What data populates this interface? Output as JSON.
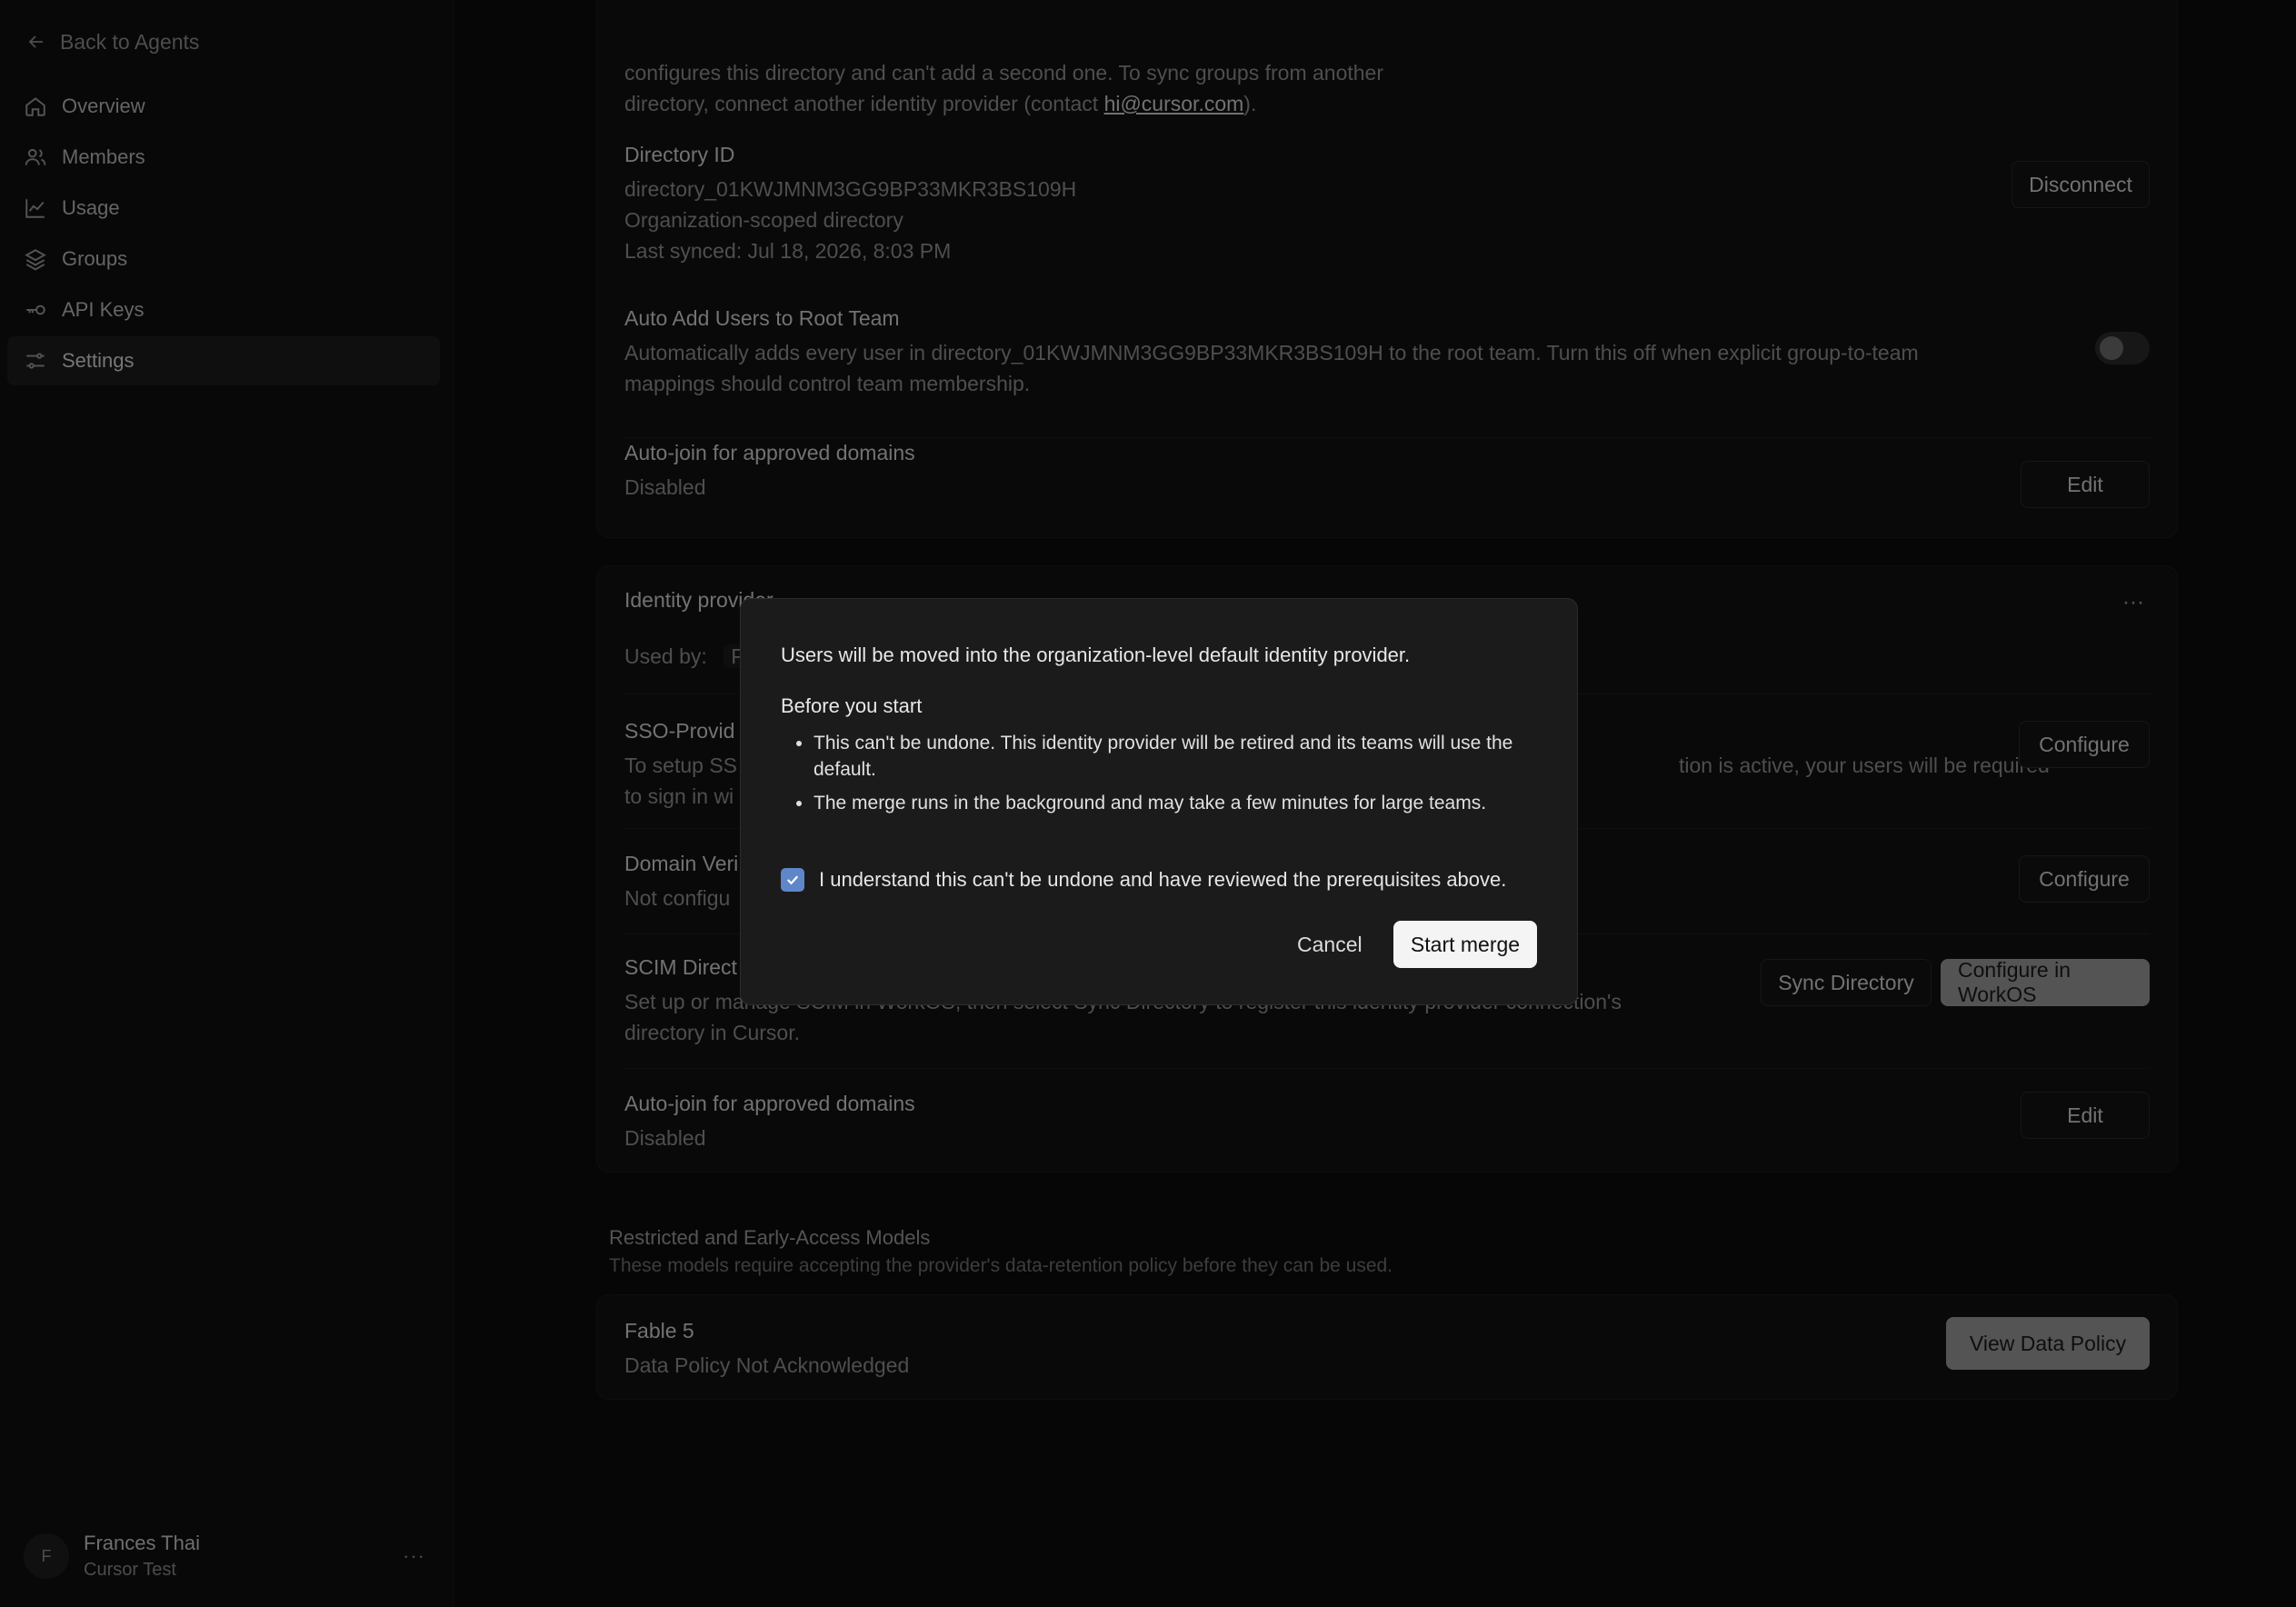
{
  "sidebar": {
    "back_label": "Back to Agents",
    "items": [
      {
        "label": "Overview",
        "icon": "home-icon"
      },
      {
        "label": "Members",
        "icon": "users-icon"
      },
      {
        "label": "Usage",
        "icon": "chart-icon"
      },
      {
        "label": "Groups",
        "icon": "layers-icon"
      },
      {
        "label": "API Keys",
        "icon": "key-icon"
      },
      {
        "label": "Settings",
        "icon": "sliders-icon",
        "active": true
      }
    ],
    "user": {
      "initial": "F",
      "name": "Frances Thai",
      "org": "Cursor Test",
      "more": "···"
    }
  },
  "directory_card": {
    "intro_line1": "configures this directory and can't add a second one. To sync groups from another",
    "intro_line2_prefix": "directory, connect another identity provider (contact ",
    "intro_link": "hi@cursor.com",
    "intro_line2_suffix": ").",
    "directory_id_title": "Directory ID",
    "directory_id": "directory_01KWJMNM3GG9BP33MKR3BS109H",
    "scope": "Organization-scoped directory",
    "last_synced": "Last synced: Jul 18, 2026, 8:03 PM",
    "disconnect_label": "Disconnect",
    "auto_add_title": "Auto Add Users to Root Team",
    "auto_add_desc_line1": "Automatically adds every user in directory_01KWJMNM3GG9BP33MKR3BS109H to the root team. Turn this off when explicit group-to-team",
    "auto_add_desc_line2": "mappings should control team membership.",
    "autojoin_title": "Auto-join for approved domains",
    "autojoin_status": "Disabled",
    "edit_label": "Edit"
  },
  "idp_card": {
    "title": "Identity provider",
    "more": "···",
    "used_by_label": "Used by:",
    "used_by_value": "P",
    "sso_title": "SSO-Provid",
    "sso_desc_left1": "To setup SS",
    "sso_desc_left2": "to sign in wi",
    "sso_desc_right": "tion is active, your users will be required",
    "configure_label": "Configure",
    "domain_title": "Domain Veri",
    "domain_status": "Not configu",
    "scim_title": "SCIM Direct",
    "scim_desc_line1": "Set up or manage SCIM in WorkOS, then select Sync Directory to register this identity provider connection's",
    "scim_desc_line2": "directory in Cursor.",
    "sync_label": "Sync Directory",
    "configure_workos_label": "Configure in WorkOS",
    "autojoin_title": "Auto-join for approved domains",
    "autojoin_status": "Disabled",
    "edit_label": "Edit"
  },
  "models_section": {
    "title": "Restricted and Early-Access Models",
    "desc": "These models require accepting the provider's data-retention policy before they can be used.",
    "model_name": "Fable 5",
    "model_status": "Data Policy Not Acknowledged",
    "view_policy_label": "View Data Policy"
  },
  "modal": {
    "intro": "Users will be moved into the organization-level default identity provider.",
    "before_title": "Before you start",
    "bullets": [
      "This can't be undone. This identity provider will be retired and its teams will use the default.",
      "The merge runs in the background and may take a few minutes for large teams."
    ],
    "checkbox_label": "I understand this can't be undone and have reviewed the prerequisites above.",
    "checkbox_checked": true,
    "cancel_label": "Cancel",
    "start_label": "Start merge"
  },
  "colors": {
    "background": "#0b0b0b",
    "checkbox_accent": "#5f86c9",
    "primary_button": "#f4f4f4"
  }
}
